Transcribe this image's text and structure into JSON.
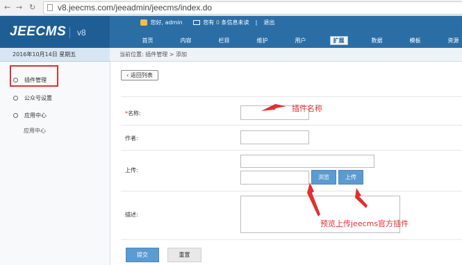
{
  "browser": {
    "url": "v8.jeecms.com/jeeadmin/jeecms/index.do",
    "back_icon": "←",
    "forward_icon": "→",
    "reload_icon": "↻"
  },
  "header": {
    "logo": "JEECMS",
    "version": "v8",
    "greeting": "您好, admin",
    "msg_prefix": "您有",
    "msg_count": "0",
    "msg_suffix": "条信息未读",
    "logout": "退出",
    "menu": [
      "首页",
      "内容",
      "栏目",
      "维护",
      "用户",
      "扩展",
      "数据",
      "模板",
      "资源"
    ],
    "active_menu": "扩展"
  },
  "date": "2016年10月14日 星期五",
  "breadcrumb": "当前位置: 插件管理 > 添加",
  "sidebar": {
    "items": [
      {
        "label": "插件管理"
      },
      {
        "label": "公众号设置"
      },
      {
        "label": "应用中心"
      }
    ],
    "sub_item": "应用中心"
  },
  "form": {
    "back_label": "返回列表",
    "back_icon": "‹",
    "name_label": "名称:",
    "required_mark": "*",
    "author_label": "作者:",
    "upload_label": "上传:",
    "browse_label": "浏览",
    "upload_button": "上传",
    "desc_label": "描述:",
    "submit_label": "提交",
    "reset_label": "重置"
  },
  "annotations": {
    "name_note": "插件名称",
    "upload_note": "预览上传jeecms官方插件"
  },
  "colors": {
    "header_bg": "#2b6ea6",
    "accent_blue": "#5b9bd2",
    "annotation_red": "#e03030"
  }
}
